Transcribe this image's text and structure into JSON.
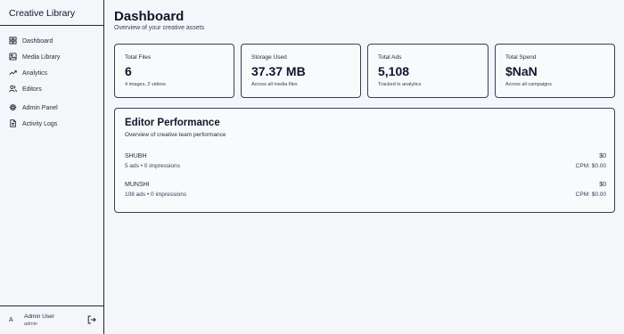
{
  "sidebar": {
    "brand": "Creative Library",
    "items": [
      {
        "label": "Dashboard",
        "icon": "dashboard-icon"
      },
      {
        "label": "Media Library",
        "icon": "image-icon"
      },
      {
        "label": "Analytics",
        "icon": "trending-up-icon"
      },
      {
        "label": "Editors",
        "icon": "users-icon"
      },
      {
        "label": "Admin Panel",
        "icon": "gear-icon"
      },
      {
        "label": "Activity Logs",
        "icon": "file-icon"
      }
    ],
    "user": {
      "avatar": "A",
      "name": "Admin User",
      "role": "admin"
    }
  },
  "header": {
    "title": "Dashboard",
    "subtitle": "Overview of your creative assets"
  },
  "stats": [
    {
      "label": "Total Files",
      "value": "6",
      "note": "4 images, 2 videos"
    },
    {
      "label": "Storage Used",
      "value": "37.37 MB",
      "note": "Across all media files"
    },
    {
      "label": "Total Ads",
      "value": "5,108",
      "note": "Tracked in analytics"
    },
    {
      "label": "Total Spend",
      "value": "$NaN",
      "note": "Across all campaigns"
    }
  ],
  "performance": {
    "title": "Editor Performance",
    "subtitle": "Overview of creative team performance",
    "editors": [
      {
        "name": "SHUBH",
        "stats": "5 ads • 0 impressions",
        "spend": "$0",
        "cpm": "CPM: $0.00"
      },
      {
        "name": "MUNSHI",
        "stats": "108 ads • 0 impressions",
        "spend": "$0",
        "cpm": "CPM: $0.00"
      }
    ]
  }
}
